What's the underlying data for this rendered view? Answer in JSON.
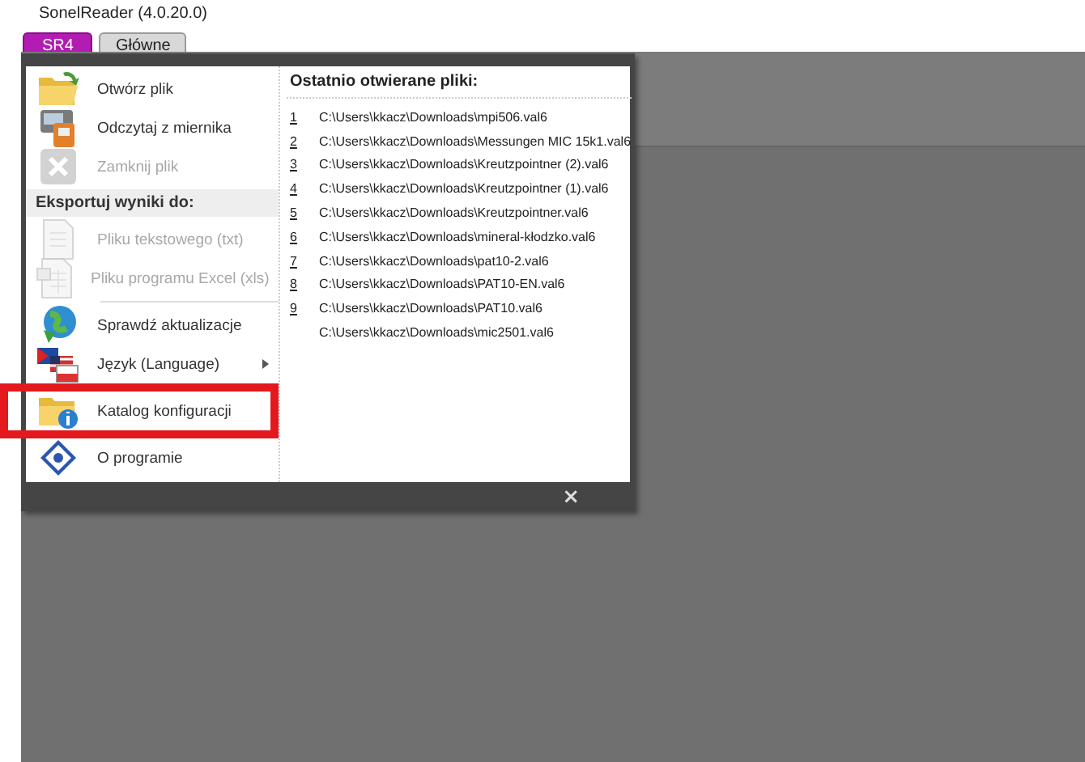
{
  "window": {
    "title": "SonelReader (4.0.20.0)"
  },
  "tabs": [
    {
      "label": "SR4",
      "selected": true
    },
    {
      "label": "Główne",
      "selected": false
    }
  ],
  "menu": {
    "items": [
      {
        "kind": "item",
        "label": "Otwórz plik",
        "disabled": false,
        "submenu": false,
        "highlighted": false
      },
      {
        "kind": "item",
        "label": "Odczytaj z miernika",
        "disabled": false,
        "submenu": false,
        "highlighted": false
      },
      {
        "kind": "item",
        "label": "Zamknij plik",
        "disabled": true,
        "submenu": false,
        "highlighted": false
      },
      {
        "kind": "header",
        "label": "Eksportuj wyniki do:"
      },
      {
        "kind": "item",
        "label": "Pliku tekstowego (txt)",
        "disabled": true,
        "submenu": false,
        "highlighted": false
      },
      {
        "kind": "item",
        "label": "Pliku programu Excel (xls)",
        "disabled": true,
        "submenu": false,
        "highlighted": false
      },
      {
        "kind": "separator"
      },
      {
        "kind": "item",
        "label": "Sprawdź aktualizacje",
        "disabled": false,
        "submenu": false,
        "highlighted": false
      },
      {
        "kind": "item",
        "label": "Język (Language)",
        "disabled": false,
        "submenu": true,
        "highlighted": false
      },
      {
        "kind": "item",
        "label": "Katalog konfiguracji",
        "disabled": false,
        "submenu": false,
        "highlighted": true
      },
      {
        "kind": "item",
        "label": "O programie",
        "disabled": false,
        "submenu": false,
        "highlighted": false
      }
    ],
    "recent_title": "Ostatnio otwierane pliki:",
    "recent_files": [
      {
        "number": "1",
        "path": "C:\\Users\\kkacz\\Downloads\\mpi506.val6"
      },
      {
        "number": "2",
        "path": "C:\\Users\\kkacz\\Downloads\\Messungen MIC 15k1.val6"
      },
      {
        "number": "3",
        "path": "C:\\Users\\kkacz\\Downloads\\Kreutzpointner (2).val6"
      },
      {
        "number": "4",
        "path": "C:\\Users\\kkacz\\Downloads\\Kreutzpointner (1).val6"
      },
      {
        "number": "5",
        "path": "C:\\Users\\kkacz\\Downloads\\Kreutzpointner.val6"
      },
      {
        "number": "6",
        "path": "C:\\Users\\kkacz\\Downloads\\mineral-kłodzko.val6"
      },
      {
        "number": "7",
        "path": "C:\\Users\\kkacz\\Downloads\\pat10-2.val6"
      },
      {
        "number": "8",
        "path": "C:\\Users\\kkacz\\Downloads\\PAT10-EN.val6"
      },
      {
        "number": "9",
        "path": "C:\\Users\\kkacz\\Downloads\\PAT10.val6"
      },
      {
        "path": "C:\\Users\\kkacz\\Downloads\\mic2501.val6"
      }
    ],
    "close_glyph": "×"
  }
}
